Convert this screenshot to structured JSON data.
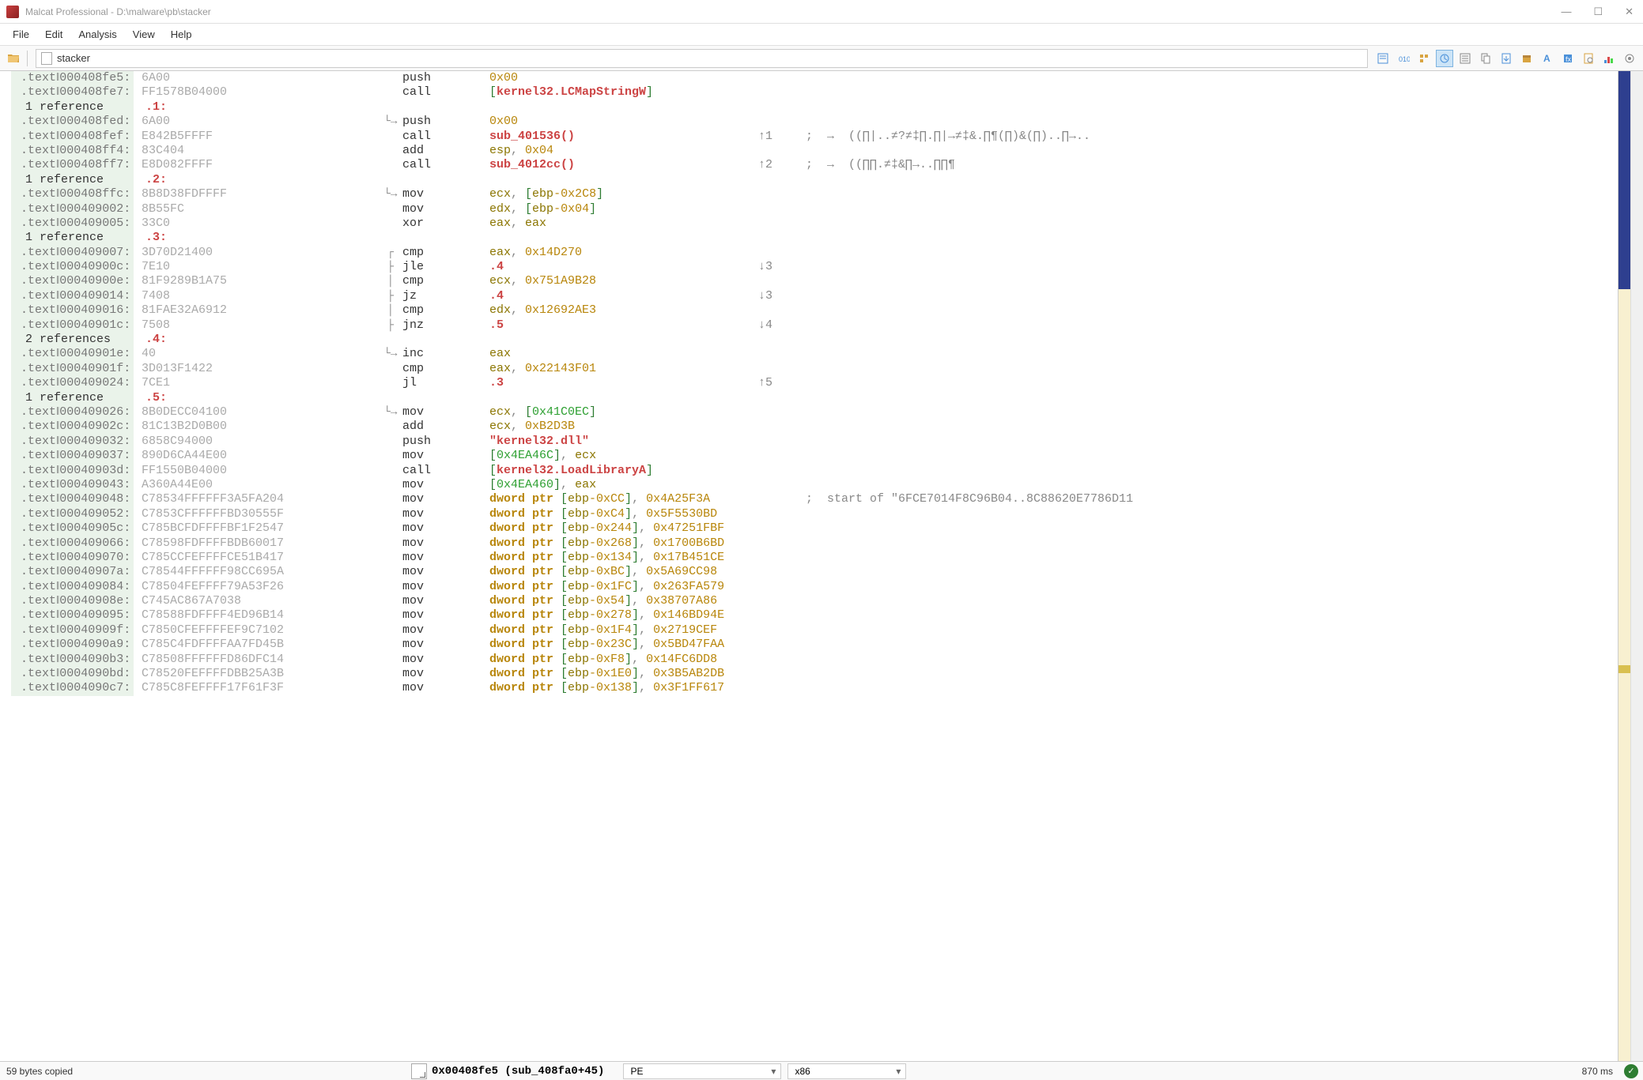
{
  "title": "Malcat Professional - D:\\malware\\pb\\stacker",
  "menu": {
    "file": "File",
    "edit": "Edit",
    "analysis": "Analysis",
    "view": "View",
    "help": "Help"
  },
  "path_box": "stacker",
  "lines": [
    {
      "addr": ".text‖000408fe5:",
      "hex": "6A00",
      "flow": "",
      "mnem": "push",
      "op": [
        {
          "t": "num",
          "v": "0x00"
        }
      ]
    },
    {
      "addr": ".text‖000408fe7:",
      "hex": "FF1578B04000",
      "flow": "",
      "mnem": "call",
      "op": [
        {
          "t": "bracket",
          "v": "["
        },
        {
          "t": "func",
          "v": "kernel32.LCMapStringW"
        },
        {
          "t": "bracket",
          "v": "]"
        }
      ]
    },
    {
      "ref": "1 reference",
      "label": ".1:"
    },
    {
      "addr": ".text‖000408fed:",
      "hex": "6A00",
      "flow": "└→",
      "mnem": "push",
      "op": [
        {
          "t": "num",
          "v": "0x00"
        }
      ]
    },
    {
      "addr": ".text‖000408fef:",
      "hex": "E842B5FFFF",
      "flow": "",
      "mnem": "call",
      "op": [
        {
          "t": "func",
          "v": "sub_401536()"
        }
      ],
      "jmp": "↑1",
      "cmt": ";  →  ((∏|..≠?≠‡∏.∏|→≠‡&.∏¶(∏)&(∏)..∏→.."
    },
    {
      "addr": ".text‖000408ff4:",
      "hex": "83C404",
      "flow": "",
      "mnem": "add",
      "op": [
        {
          "t": "reg",
          "v": "esp"
        },
        {
          "t": "punct",
          "v": ", "
        },
        {
          "t": "num",
          "v": "0x04"
        }
      ]
    },
    {
      "addr": ".text‖000408ff7:",
      "hex": "E8D082FFFF",
      "flow": "",
      "mnem": "call",
      "op": [
        {
          "t": "func",
          "v": "sub_4012cc()"
        }
      ],
      "jmp": "↑2",
      "cmt": ";  →  ((∏∏.≠‡&∏→..∏∏¶"
    },
    {
      "ref": "1 reference",
      "label": ".2:"
    },
    {
      "addr": ".text‖000408ffc:",
      "hex": "8B8D38FDFFFF",
      "flow": "└→",
      "mnem": "mov",
      "op": [
        {
          "t": "reg",
          "v": "ecx"
        },
        {
          "t": "punct",
          "v": ", "
        },
        {
          "t": "bracket",
          "v": "["
        },
        {
          "t": "reg",
          "v": "ebp"
        },
        {
          "t": "num",
          "v": "-0x2C8"
        },
        {
          "t": "bracket",
          "v": "]"
        }
      ]
    },
    {
      "addr": ".text‖000409002:",
      "hex": "8B55FC",
      "flow": "",
      "mnem": "mov",
      "op": [
        {
          "t": "reg",
          "v": "edx"
        },
        {
          "t": "punct",
          "v": ", "
        },
        {
          "t": "bracket",
          "v": "["
        },
        {
          "t": "reg",
          "v": "ebp"
        },
        {
          "t": "num",
          "v": "-0x04"
        },
        {
          "t": "bracket",
          "v": "]"
        }
      ]
    },
    {
      "addr": ".text‖000409005:",
      "hex": "33C0",
      "flow": "",
      "mnem": "xor",
      "op": [
        {
          "t": "reg",
          "v": "eax"
        },
        {
          "t": "punct",
          "v": ", "
        },
        {
          "t": "reg",
          "v": "eax"
        }
      ]
    },
    {
      "ref": "1 reference",
      "label": ".3:"
    },
    {
      "addr": ".text‖000409007:",
      "hex": "3D70D21400",
      "flow": "┌",
      "mnem": "cmp",
      "op": [
        {
          "t": "reg",
          "v": "eax"
        },
        {
          "t": "punct",
          "v": ", "
        },
        {
          "t": "num",
          "v": "0x14D270"
        }
      ]
    },
    {
      "addr": ".text‖00040900c:",
      "hex": "7E10",
      "flow": "├",
      "mnem": "jle",
      "op": [
        {
          "t": "lbl",
          "v": ".4"
        }
      ],
      "jmp": "↓3"
    },
    {
      "addr": ".text‖00040900e:",
      "hex": "81F9289B1A75",
      "flow": "│",
      "mnem": "cmp",
      "op": [
        {
          "t": "reg",
          "v": "ecx"
        },
        {
          "t": "punct",
          "v": ", "
        },
        {
          "t": "num",
          "v": "0x751A9B28"
        }
      ]
    },
    {
      "addr": ".text‖000409014:",
      "hex": "7408",
      "flow": "├",
      "mnem": "jz",
      "op": [
        {
          "t": "lbl",
          "v": ".4"
        }
      ],
      "jmp": "↓3"
    },
    {
      "addr": ".text‖000409016:",
      "hex": "81FAE32A6912",
      "flow": "│",
      "mnem": "cmp",
      "op": [
        {
          "t": "reg",
          "v": "edx"
        },
        {
          "t": "punct",
          "v": ", "
        },
        {
          "t": "num",
          "v": "0x12692AE3"
        }
      ]
    },
    {
      "addr": ".text‖00040901c:",
      "hex": "7508",
      "flow": "├",
      "mnem": "jnz",
      "op": [
        {
          "t": "lbl",
          "v": ".5"
        }
      ],
      "jmp": "↓4"
    },
    {
      "ref": "2 references",
      "label": ".4:"
    },
    {
      "addr": ".text‖00040901e:",
      "hex": "40",
      "flow": "└→",
      "mnem": "inc",
      "op": [
        {
          "t": "reg",
          "v": "eax"
        }
      ]
    },
    {
      "addr": ".text‖00040901f:",
      "hex": "3D013F1422",
      "flow": "",
      "mnem": "cmp",
      "op": [
        {
          "t": "reg",
          "v": "eax"
        },
        {
          "t": "punct",
          "v": ", "
        },
        {
          "t": "num",
          "v": "0x22143F01"
        }
      ]
    },
    {
      "addr": ".text‖000409024:",
      "hex": "7CE1",
      "flow": "",
      "mnem": "jl",
      "op": [
        {
          "t": "lbl",
          "v": ".3"
        }
      ],
      "jmp": "↑5"
    },
    {
      "ref": "1 reference",
      "label": ".5:"
    },
    {
      "addr": ".text‖000409026:",
      "hex": "8B0DECC04100",
      "flow": "└→",
      "mnem": "mov",
      "op": [
        {
          "t": "reg",
          "v": "ecx"
        },
        {
          "t": "punct",
          "v": ", "
        },
        {
          "t": "bracket",
          "v": "["
        },
        {
          "t": "memref",
          "v": "0x41C0EC"
        },
        {
          "t": "bracket",
          "v": "]"
        }
      ]
    },
    {
      "addr": ".text‖00040902c:",
      "hex": "81C13B2D0B00",
      "flow": "",
      "mnem": "add",
      "op": [
        {
          "t": "reg",
          "v": "ecx"
        },
        {
          "t": "punct",
          "v": ", "
        },
        {
          "t": "num",
          "v": "0xB2D3B"
        }
      ]
    },
    {
      "addr": ".text‖000409032:",
      "hex": "6858C94000",
      "flow": "",
      "mnem": "push",
      "op": [
        {
          "t": "str",
          "v": "\"kernel32.dll\""
        }
      ]
    },
    {
      "addr": ".text‖000409037:",
      "hex": "890D6CA44E00",
      "flow": "",
      "mnem": "mov",
      "op": [
        {
          "t": "bracket",
          "v": "["
        },
        {
          "t": "memref",
          "v": "0x4EA46C"
        },
        {
          "t": "bracket",
          "v": "]"
        },
        {
          "t": "punct",
          "v": ", "
        },
        {
          "t": "reg",
          "v": "ecx"
        }
      ]
    },
    {
      "addr": ".text‖00040903d:",
      "hex": "FF1550B04000",
      "flow": "",
      "mnem": "call",
      "op": [
        {
          "t": "bracket",
          "v": "["
        },
        {
          "t": "func",
          "v": "kernel32.LoadLibraryA"
        },
        {
          "t": "bracket",
          "v": "]"
        }
      ]
    },
    {
      "addr": ".text‖000409043:",
      "hex": "A360A44E00",
      "flow": "",
      "mnem": "mov",
      "op": [
        {
          "t": "bracket",
          "v": "["
        },
        {
          "t": "memref",
          "v": "0x4EA460"
        },
        {
          "t": "bracket",
          "v": "]"
        },
        {
          "t": "punct",
          "v": ", "
        },
        {
          "t": "reg",
          "v": "eax"
        }
      ]
    },
    {
      "addr": ".text‖000409048:",
      "hex": "C78534FFFFFF3A5FA204",
      "flow": "",
      "mnem": "mov",
      "op": [
        {
          "t": "kw",
          "v": "dword ptr "
        },
        {
          "t": "bracket",
          "v": "["
        },
        {
          "t": "reg",
          "v": "ebp"
        },
        {
          "t": "num",
          "v": "-0xCC"
        },
        {
          "t": "bracket",
          "v": "]"
        },
        {
          "t": "punct",
          "v": ", "
        },
        {
          "t": "num",
          "v": "0x4A25F3A"
        }
      ],
      "cmt": ";  start of \"6FCE7014F8C96B04..8C88620E7786D11"
    },
    {
      "addr": ".text‖000409052:",
      "hex": "C7853CFFFFFFBD30555F",
      "flow": "",
      "mnem": "mov",
      "op": [
        {
          "t": "kw",
          "v": "dword ptr "
        },
        {
          "t": "bracket",
          "v": "["
        },
        {
          "t": "reg",
          "v": "ebp"
        },
        {
          "t": "num",
          "v": "-0xC4"
        },
        {
          "t": "bracket",
          "v": "]"
        },
        {
          "t": "punct",
          "v": ", "
        },
        {
          "t": "num",
          "v": "0x5F5530BD"
        }
      ]
    },
    {
      "addr": ".text‖00040905c:",
      "hex": "C785BCFDFFFFBF1F2547",
      "flow": "",
      "mnem": "mov",
      "op": [
        {
          "t": "kw",
          "v": "dword ptr "
        },
        {
          "t": "bracket",
          "v": "["
        },
        {
          "t": "reg",
          "v": "ebp"
        },
        {
          "t": "num",
          "v": "-0x244"
        },
        {
          "t": "bracket",
          "v": "]"
        },
        {
          "t": "punct",
          "v": ", "
        },
        {
          "t": "num",
          "v": "0x47251FBF"
        }
      ]
    },
    {
      "addr": ".text‖000409066:",
      "hex": "C78598FDFFFFBDB60017",
      "flow": "",
      "mnem": "mov",
      "op": [
        {
          "t": "kw",
          "v": "dword ptr "
        },
        {
          "t": "bracket",
          "v": "["
        },
        {
          "t": "reg",
          "v": "ebp"
        },
        {
          "t": "num",
          "v": "-0x268"
        },
        {
          "t": "bracket",
          "v": "]"
        },
        {
          "t": "punct",
          "v": ", "
        },
        {
          "t": "num",
          "v": "0x1700B6BD"
        }
      ]
    },
    {
      "addr": ".text‖000409070:",
      "hex": "C785CCFEFFFFCE51B417",
      "flow": "",
      "mnem": "mov",
      "op": [
        {
          "t": "kw",
          "v": "dword ptr "
        },
        {
          "t": "bracket",
          "v": "["
        },
        {
          "t": "reg",
          "v": "ebp"
        },
        {
          "t": "num",
          "v": "-0x134"
        },
        {
          "t": "bracket",
          "v": "]"
        },
        {
          "t": "punct",
          "v": ", "
        },
        {
          "t": "num",
          "v": "0x17B451CE"
        }
      ]
    },
    {
      "addr": ".text‖00040907a:",
      "hex": "C78544FFFFFF98CC695A",
      "flow": "",
      "mnem": "mov",
      "op": [
        {
          "t": "kw",
          "v": "dword ptr "
        },
        {
          "t": "bracket",
          "v": "["
        },
        {
          "t": "reg",
          "v": "ebp"
        },
        {
          "t": "num",
          "v": "-0xBC"
        },
        {
          "t": "bracket",
          "v": "]"
        },
        {
          "t": "punct",
          "v": ", "
        },
        {
          "t": "num",
          "v": "0x5A69CC98"
        }
      ]
    },
    {
      "addr": ".text‖000409084:",
      "hex": "C78504FEFFFF79A53F26",
      "flow": "",
      "mnem": "mov",
      "op": [
        {
          "t": "kw",
          "v": "dword ptr "
        },
        {
          "t": "bracket",
          "v": "["
        },
        {
          "t": "reg",
          "v": "ebp"
        },
        {
          "t": "num",
          "v": "-0x1FC"
        },
        {
          "t": "bracket",
          "v": "]"
        },
        {
          "t": "punct",
          "v": ", "
        },
        {
          "t": "num",
          "v": "0x263FA579"
        }
      ]
    },
    {
      "addr": ".text‖00040908e:",
      "hex": "C745AC867A7038",
      "flow": "",
      "mnem": "mov",
      "op": [
        {
          "t": "kw",
          "v": "dword ptr "
        },
        {
          "t": "bracket",
          "v": "["
        },
        {
          "t": "reg",
          "v": "ebp"
        },
        {
          "t": "num",
          "v": "-0x54"
        },
        {
          "t": "bracket",
          "v": "]"
        },
        {
          "t": "punct",
          "v": ", "
        },
        {
          "t": "num",
          "v": "0x38707A86"
        }
      ]
    },
    {
      "addr": ".text‖000409095:",
      "hex": "C78588FDFFFF4ED96B14",
      "flow": "",
      "mnem": "mov",
      "op": [
        {
          "t": "kw",
          "v": "dword ptr "
        },
        {
          "t": "bracket",
          "v": "["
        },
        {
          "t": "reg",
          "v": "ebp"
        },
        {
          "t": "num",
          "v": "-0x278"
        },
        {
          "t": "bracket",
          "v": "]"
        },
        {
          "t": "punct",
          "v": ", "
        },
        {
          "t": "num",
          "v": "0x146BD94E"
        }
      ]
    },
    {
      "addr": ".text‖00040909f:",
      "hex": "C7850CFEFFFFEF9C7102",
      "flow": "",
      "mnem": "mov",
      "op": [
        {
          "t": "kw",
          "v": "dword ptr "
        },
        {
          "t": "bracket",
          "v": "["
        },
        {
          "t": "reg",
          "v": "ebp"
        },
        {
          "t": "num",
          "v": "-0x1F4"
        },
        {
          "t": "bracket",
          "v": "]"
        },
        {
          "t": "punct",
          "v": ", "
        },
        {
          "t": "num",
          "v": "0x2719CEF"
        }
      ]
    },
    {
      "addr": ".text‖0004090a9:",
      "hex": "C785C4FDFFFFAA7FD45B",
      "flow": "",
      "mnem": "mov",
      "op": [
        {
          "t": "kw",
          "v": "dword ptr "
        },
        {
          "t": "bracket",
          "v": "["
        },
        {
          "t": "reg",
          "v": "ebp"
        },
        {
          "t": "num",
          "v": "-0x23C"
        },
        {
          "t": "bracket",
          "v": "]"
        },
        {
          "t": "punct",
          "v": ", "
        },
        {
          "t": "num",
          "v": "0x5BD47FAA"
        }
      ]
    },
    {
      "addr": ".text‖0004090b3:",
      "hex": "C78508FFFFFFD86DFC14",
      "flow": "",
      "mnem": "mov",
      "op": [
        {
          "t": "kw",
          "v": "dword ptr "
        },
        {
          "t": "bracket",
          "v": "["
        },
        {
          "t": "reg",
          "v": "ebp"
        },
        {
          "t": "num",
          "v": "-0xF8"
        },
        {
          "t": "bracket",
          "v": "]"
        },
        {
          "t": "punct",
          "v": ", "
        },
        {
          "t": "num",
          "v": "0x14FC6DD8"
        }
      ]
    },
    {
      "addr": ".text‖0004090bd:",
      "hex": "C78520FEFFFFDBB25A3B",
      "flow": "",
      "mnem": "mov",
      "op": [
        {
          "t": "kw",
          "v": "dword ptr "
        },
        {
          "t": "bracket",
          "v": "["
        },
        {
          "t": "reg",
          "v": "ebp"
        },
        {
          "t": "num",
          "v": "-0x1E0"
        },
        {
          "t": "bracket",
          "v": "]"
        },
        {
          "t": "punct",
          "v": ", "
        },
        {
          "t": "num",
          "v": "0x3B5AB2DB"
        }
      ]
    },
    {
      "addr": ".text‖0004090c7:",
      "hex": "C785C8FEFFFF17F61F3F",
      "flow": "",
      "mnem": "mov",
      "op": [
        {
          "t": "kw",
          "v": "dword ptr "
        },
        {
          "t": "bracket",
          "v": "["
        },
        {
          "t": "reg",
          "v": "ebp"
        },
        {
          "t": "num",
          "v": "-0x138"
        },
        {
          "t": "bracket",
          "v": "]"
        },
        {
          "t": "punct",
          "v": ", "
        },
        {
          "t": "num",
          "v": "0x3F1FF617"
        }
      ]
    }
  ],
  "status": {
    "left": "59 bytes copied",
    "addr": "0x00408fe5 (sub_408fa0+45)",
    "format": "PE",
    "arch": "x86",
    "timing": "870 ms"
  }
}
